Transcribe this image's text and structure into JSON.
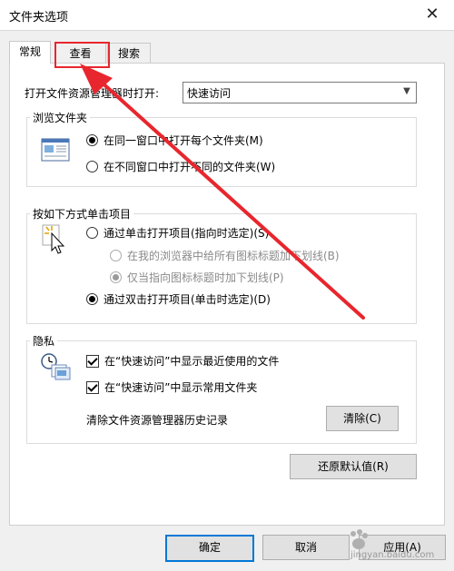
{
  "window": {
    "title": "文件夹选项",
    "close_glyph": "✕"
  },
  "tabs": [
    {
      "label": "常规",
      "active": true
    },
    {
      "label": "查看",
      "active": false,
      "highlighted": true
    },
    {
      "label": "搜索",
      "active": false
    }
  ],
  "general": {
    "open_explorer_label": "打开文件资源管理器时打开:",
    "open_explorer_value": "快速访问",
    "browse_group": {
      "title": "浏览文件夹",
      "icon": "window-folder-icon",
      "options": [
        {
          "label": "在同一窗口中打开每个文件夹(M)",
          "checked": true
        },
        {
          "label": "在不同窗口中打开不同的文件夹(W)",
          "checked": false
        }
      ]
    },
    "click_group": {
      "title": "按如下方式单击项目",
      "icon": "pointer-click-icon",
      "options": [
        {
          "label": "通过单击打开项目(指向时选定)(S)",
          "checked": false
        },
        {
          "label": "在我的浏览器中给所有图标标题加下划线(B)",
          "checked": false,
          "disabled": true
        },
        {
          "label": "仅当指向图标标题时加下划线(P)",
          "checked": true,
          "disabled": true
        },
        {
          "label": "通过双击打开项目(单击时选定)(D)",
          "checked": true
        }
      ]
    },
    "privacy_group": {
      "title": "隐私",
      "icon": "clock-documents-icon",
      "checks": [
        {
          "label": "在“快速访问”中显示最近使用的文件",
          "checked": true
        },
        {
          "label": "在“快速访问”中显示常用文件夹",
          "checked": true
        }
      ],
      "clear_label": "清除文件资源管理器历史记录",
      "clear_button": "清除(C)"
    },
    "restore_button": "还原默认值(R)"
  },
  "footer": {
    "ok": "确定",
    "cancel": "取消",
    "apply": "应用(A)"
  },
  "annotation": {
    "color": "#e8262d"
  },
  "watermark": {
    "text": "jingyan.baidu.com"
  }
}
